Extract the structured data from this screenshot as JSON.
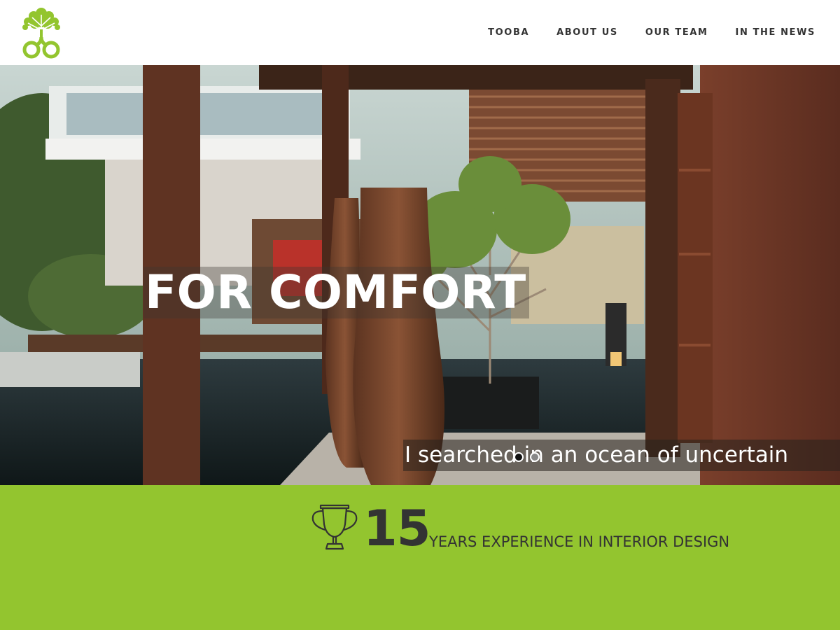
{
  "header": {
    "logo_icon": "tree-with-roots-logo-icon",
    "nav": [
      {
        "label": "TOOBA"
      },
      {
        "label": "ABOUT US"
      },
      {
        "label": "OUR TEAM"
      },
      {
        "label": "IN THE NEWS"
      }
    ]
  },
  "hero": {
    "title": "FOR COMFORT",
    "subtitle": "I searched in an ocean of uncertain",
    "slides": {
      "count": 2,
      "active": 1
    }
  },
  "stats": {
    "icon": "trophy-icon",
    "number": "15",
    "label": "YEARS EXPERIENCE IN INTERIOR DESIGN"
  },
  "colors": {
    "brand_green": "#93c52f",
    "text_dark": "#333333",
    "header_bg": "#ffffff"
  }
}
